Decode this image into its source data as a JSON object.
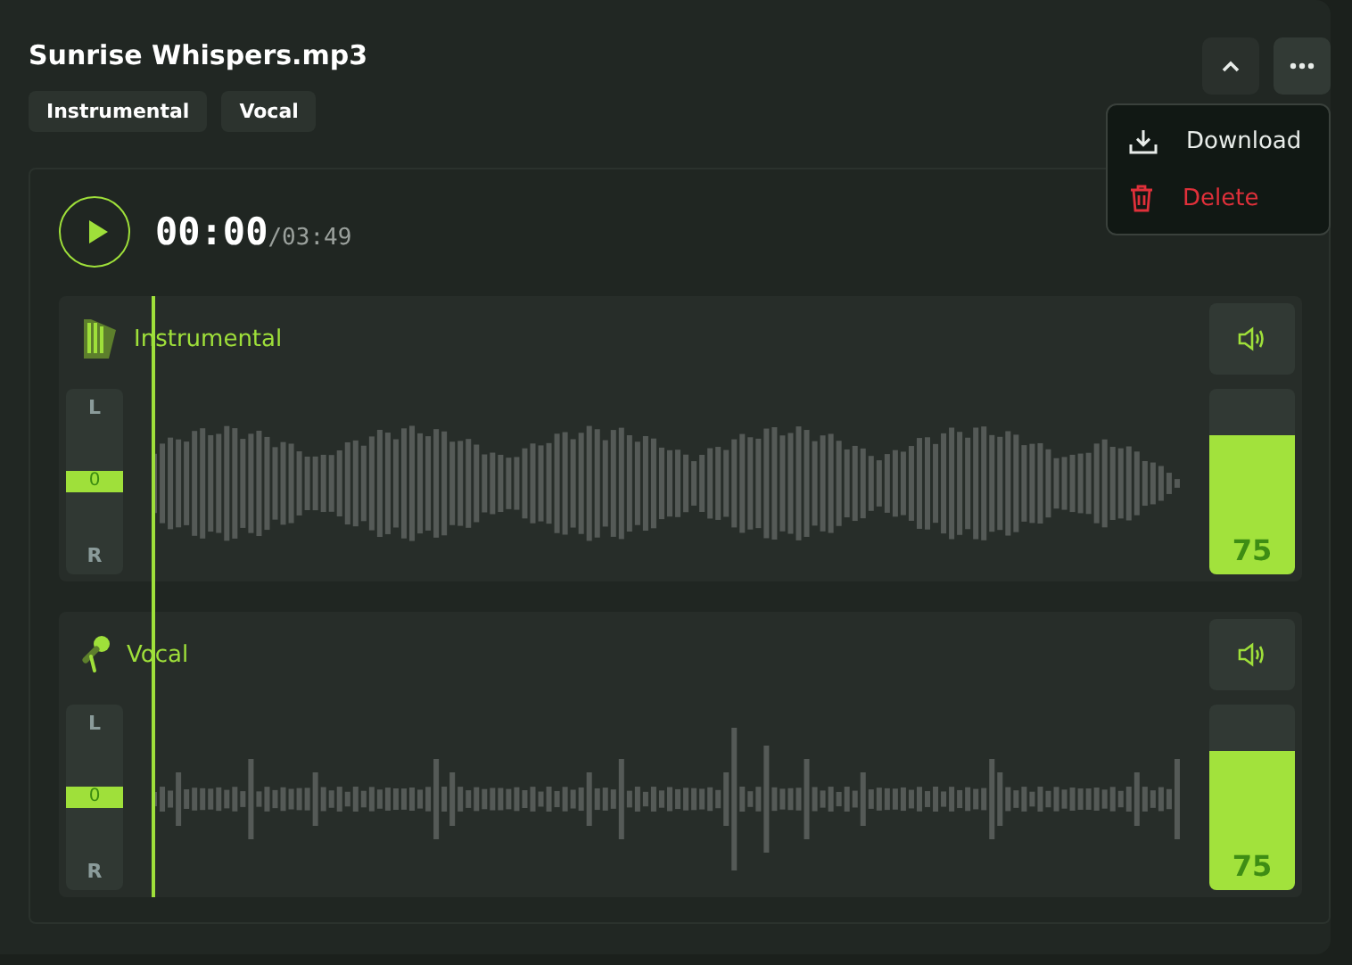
{
  "file": {
    "title": "Sunrise Whispers.mp3",
    "tags": [
      "Instrumental",
      "Vocal"
    ]
  },
  "menu": {
    "items": [
      {
        "kind": "download",
        "label": "Download"
      },
      {
        "kind": "delete",
        "label": "Delete"
      }
    ]
  },
  "player": {
    "current": "00:00",
    "duration": "/03:49"
  },
  "tracks": [
    {
      "kind": "instrumental",
      "name": "Instrumental",
      "pan": {
        "left": "L",
        "right": "R",
        "value": "0",
        "level": 0.5
      },
      "volume": {
        "level": 0.75,
        "reading": "75"
      }
    },
    {
      "kind": "vocal",
      "name": "Vocal",
      "pan": {
        "left": "L",
        "right": "R",
        "value": "0",
        "level": 0.5
      },
      "volume": {
        "level": 0.75,
        "reading": "75"
      }
    }
  ]
}
